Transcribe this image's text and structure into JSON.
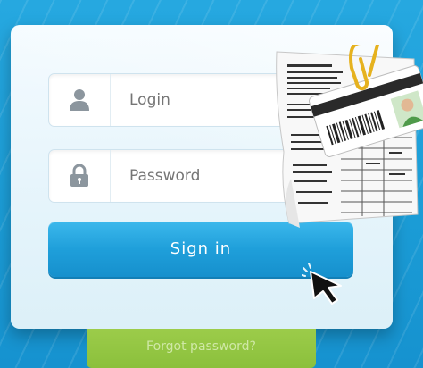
{
  "login": {
    "placeholder": "Login",
    "icon": "user-icon"
  },
  "password": {
    "placeholder": "Password",
    "icon": "lock-icon"
  },
  "signin": {
    "label": "Sign in"
  },
  "forgot": {
    "label": "Forgot password?"
  },
  "colors": {
    "background": "#1b9fd8",
    "button": "#1f9fda",
    "forgot": "#8bc03c"
  }
}
